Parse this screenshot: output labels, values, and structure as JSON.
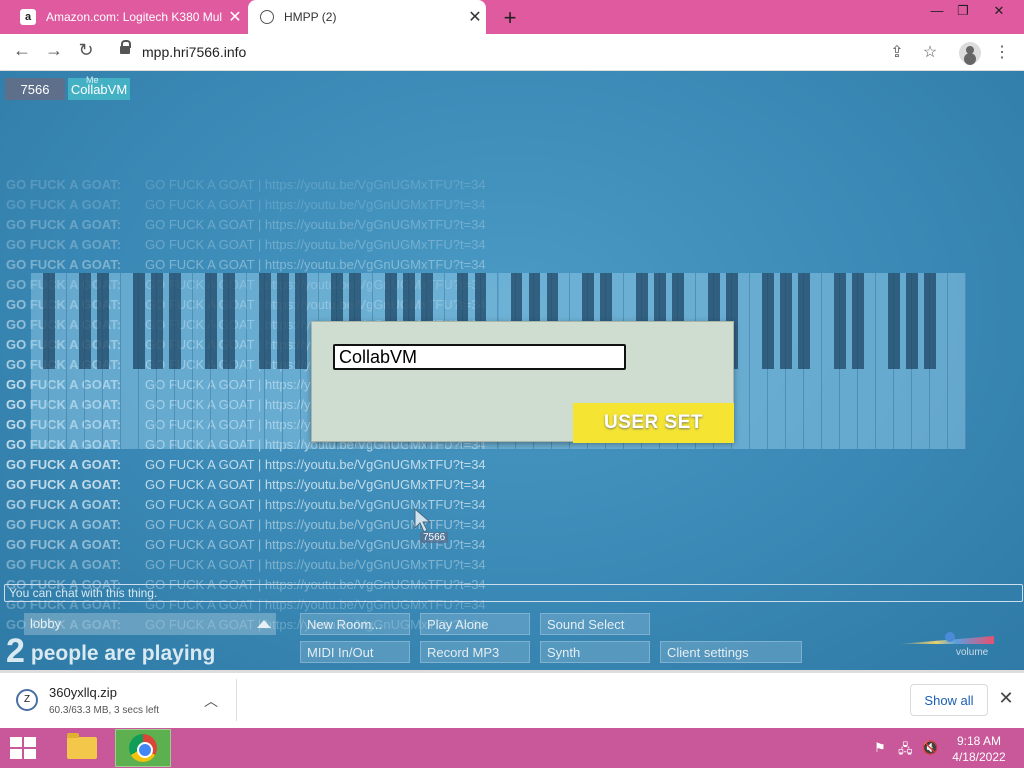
{
  "browser": {
    "tabs": [
      {
        "label": "Amazon.com: Logitech K380 Mul",
        "favicon": "a"
      },
      {
        "label": "HMPP (2)"
      }
    ],
    "new_tab": "+",
    "url": "mpp.hri7566.info"
  },
  "room": {
    "chips": [
      {
        "label": "7566"
      },
      {
        "label": "CollabVM",
        "tag": "Me"
      }
    ],
    "chat": [
      {
        "name": "GO FUCK A GOAT:",
        "text": "GO FUCK A GOAT | https://youtu.be/VgGnUGMxTFU?t=34"
      },
      {
        "name": "GO FUCK A GOAT:",
        "text": "GO FUCK A GOAT | https://youtu.be/VgGnUGMxTFU?t=34"
      },
      {
        "name": "GO FUCK A GOAT:",
        "text": "GO FUCK A GOAT | https://youtu.be/VgGnUGMxTFU?t=34"
      },
      {
        "name": "GO FUCK A GOAT:",
        "text": "GO FUCK A GOAT | https://youtu.be/VgGnUGMxTFU?t=34"
      },
      {
        "name": "GO FUCK A GOAT:",
        "text": "GO FUCK A GOAT | https://youtu.be/VgGnUGMxTFU?t=34"
      },
      {
        "name": "GO FUCK A GOAT:",
        "text": "GO FUCK A GOAT | https://youtu.be/VgGnUGMxTFU?t=34"
      },
      {
        "name": "GO FUCK A GOAT:",
        "text": "GO FUCK A GOAT | https://youtu.be/VgGnUGMxTFU?t=34"
      },
      {
        "name": "GO FUCK A GOAT:",
        "text": "GO FUCK A GOAT | https://youtu.be/VgGnUGMxTFU?t=34"
      },
      {
        "name": "GO FUCK A GOAT:",
        "text": "GO FUCK A GOAT | https://youtu.be/VgGnUGMxTFU?t=34"
      },
      {
        "name": "GO FUCK A GOAT:",
        "text": "GO FUCK A GOAT | https://youtu.be/VgGnUGMxTFU?t=34"
      },
      {
        "name": "GO FUCK A GOAT:",
        "text": "GO FUCK A GOAT | https://youtu.be/VgGnUGMxTFU?t=34"
      },
      {
        "name": "GO FUCK A GOAT:",
        "text": "GO FUCK A GOAT | https://youtu.be/VgGnUGMxTFU?t=34"
      },
      {
        "name": "GO FUCK A GOAT:",
        "text": "GO FUCK A GOAT | https://youtu.be/VgGnUGMxTFU?t=34"
      },
      {
        "name": "GO FUCK A GOAT:",
        "text": "GO FUCK A GOAT | https://youtu.be/VgGnUGMxTFU?t=34"
      },
      {
        "name": "GO FUCK A GOAT:",
        "text": "GO FUCK A GOAT | https://youtu.be/VgGnUGMxTFU?t=34"
      },
      {
        "name": "GO FUCK A GOAT:",
        "text": "GO FUCK A GOAT | https://youtu.be/VgGnUGMxTFU?t=34"
      },
      {
        "name": "GO FUCK A GOAT:",
        "text": "GO FUCK A GOAT | https://youtu.be/VgGnUGMxTFU?t=34"
      },
      {
        "name": "GO FUCK A GOAT:",
        "text": "GO FUCK A GOAT | https://youtu.be/VgGnUGMxTFU?t=34"
      },
      {
        "name": "GO FUCK A GOAT:",
        "text": "GO FUCK A GOAT | https://youtu.be/VgGnUGMxTFU?t=34"
      },
      {
        "name": "GO FUCK A GOAT:",
        "text": "GO FUCK A GOAT | https://youtu.be/VgGnUGMxTFU?t=34"
      },
      {
        "name": "GO FUCK A GOAT:",
        "text": "GO FUCK A GOAT | https://youtu.be/VgGnUGMxTFU?t=34"
      },
      {
        "name": "GO FUCK A GOAT:",
        "text": "GO FUCK A GOAT | https://youtu.be/VgGnUGMxTFU?t=34"
      },
      {
        "name": "GO FUCK A GOAT:",
        "text": "GO FUCK A GOAT | https://youtu.be/VgGnUGMxTFU?t=34"
      }
    ],
    "dialog": {
      "input_value": "CollabVM",
      "button": "USER SET"
    },
    "cursor_tag": "7566",
    "chat_placeholder": "You can chat with this thing.",
    "room_select": "lobby",
    "players_count": "2",
    "players_label": "people are playing",
    "buttons": [
      "New Room...",
      "Play Alone",
      "Sound Select",
      "MIDI In/Out",
      "Record MP3",
      "Synth",
      "Client settings"
    ],
    "volume_label": "volume",
    "volume_level": 0.55
  },
  "download": {
    "file": "360yxllq.zip",
    "status": "60.3/63.3 MB, 3 secs left",
    "show_all": "Show all"
  },
  "taskbar": {
    "time": "9:18 AM",
    "date": "4/18/2022"
  },
  "colors": {
    "tabbar": "#e05aa0",
    "taskbar": "#c9589a",
    "page_bg": "#3c8bb8",
    "user_set_button": "#f5e532"
  }
}
